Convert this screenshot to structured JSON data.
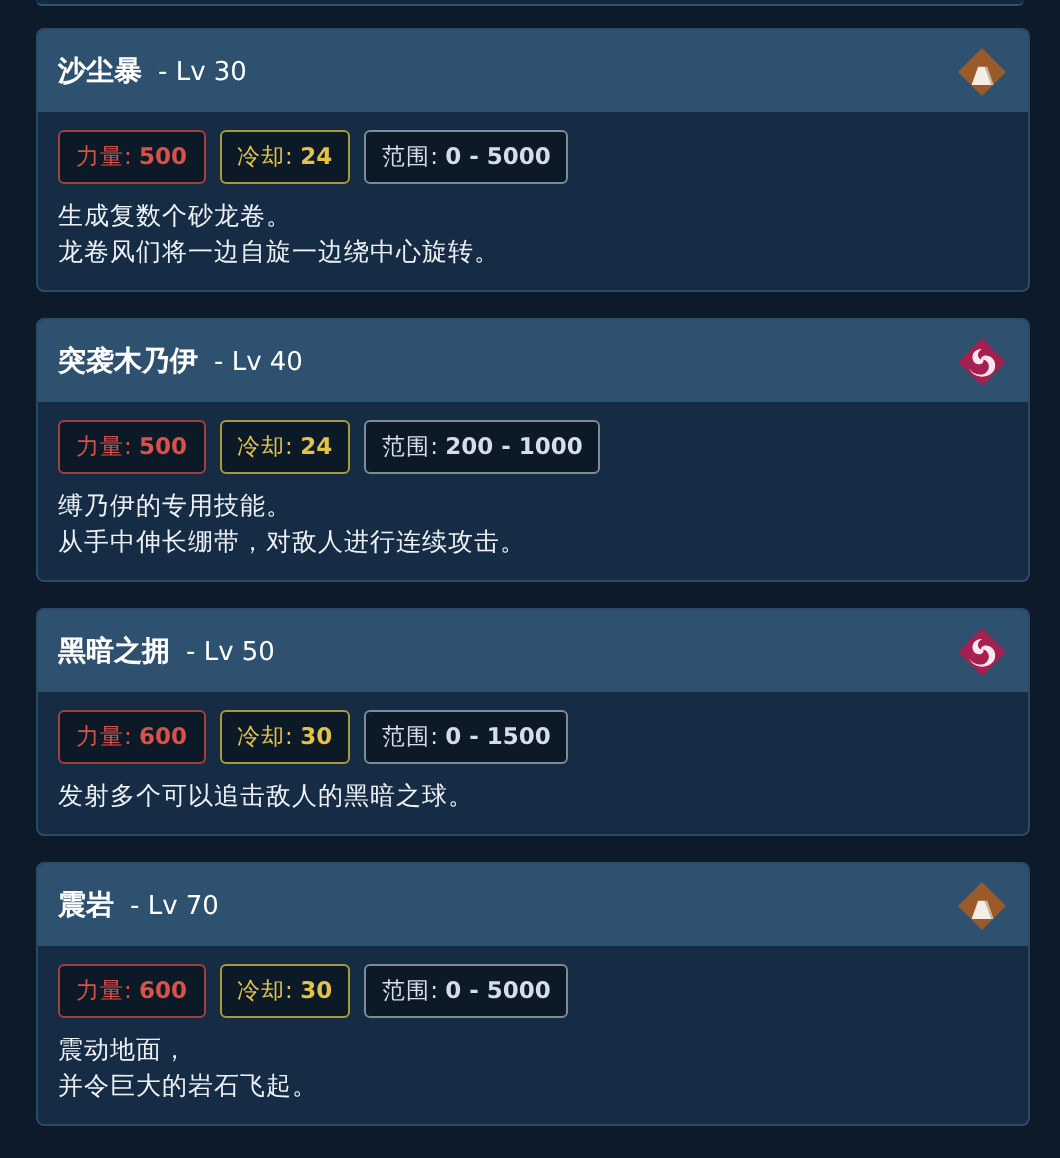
{
  "skills": [
    {
      "name": "沙尘暴",
      "level_text": "- Lv 30",
      "kind": "earth",
      "stats": [
        {
          "kind": "power",
          "label": "力量:",
          "value": "500"
        },
        {
          "kind": "cooldown",
          "label": "冷却:",
          "value": "24"
        },
        {
          "kind": "range",
          "label": "范围:",
          "value": "0 - 5000"
        }
      ],
      "description": [
        "生成复数个砂龙卷。",
        "龙卷风们将一边自旋一边绕中心旋转。"
      ]
    },
    {
      "name": "突袭木乃伊",
      "level_text": "- Lv 40",
      "kind": "spiral",
      "stats": [
        {
          "kind": "power",
          "label": "力量:",
          "value": "500"
        },
        {
          "kind": "cooldown",
          "label": "冷却:",
          "value": "24"
        },
        {
          "kind": "range",
          "label": "范围:",
          "value": "200 - 1000"
        }
      ],
      "description": [
        "缚乃伊的专用技能。",
        "从手中伸长绷带，对敌人进行连续攻击。"
      ]
    },
    {
      "name": "黑暗之拥",
      "level_text": "- Lv 50",
      "kind": "spiral",
      "stats": [
        {
          "kind": "power",
          "label": "力量:",
          "value": "600"
        },
        {
          "kind": "cooldown",
          "label": "冷却:",
          "value": "30"
        },
        {
          "kind": "range",
          "label": "范围:",
          "value": "0 - 1500"
        }
      ],
      "description": [
        "发射多个可以追击敌人的黑暗之球。"
      ]
    },
    {
      "name": "震岩",
      "level_text": "- Lv 70",
      "kind": "earth",
      "stats": [
        {
          "kind": "power",
          "label": "力量:",
          "value": "600"
        },
        {
          "kind": "cooldown",
          "label": "冷却:",
          "value": "30"
        },
        {
          "kind": "range",
          "label": "范围:",
          "value": "0 - 5000"
        }
      ],
      "description": [
        "震动地面，",
        "并令巨大的岩石飞起。"
      ]
    }
  ]
}
